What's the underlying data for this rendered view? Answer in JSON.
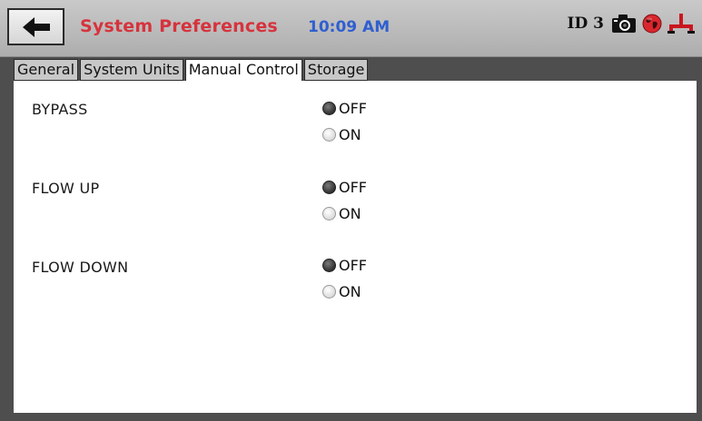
{
  "header": {
    "title": "System Preferences",
    "time": "10:09 AM",
    "id_label": "ID 3",
    "icons": [
      "back-arrow-icon",
      "camera-icon",
      "globe-icon",
      "network-icon"
    ]
  },
  "tabs": [
    {
      "label": "General",
      "active": false
    },
    {
      "label": "System Units",
      "active": false
    },
    {
      "label": "Manual Control",
      "active": true
    },
    {
      "label": "Storage",
      "active": false
    }
  ],
  "controls": [
    {
      "label": "BYPASS",
      "options": [
        "OFF",
        "ON"
      ],
      "selected": "OFF"
    },
    {
      "label": "FLOW UP",
      "options": [
        "OFF",
        "ON"
      ],
      "selected": "OFF"
    },
    {
      "label": "FLOW DOWN",
      "options": [
        "OFF",
        "ON"
      ],
      "selected": "OFF"
    }
  ],
  "colors": {
    "title": "#d6333d",
    "time": "#2f5fd0",
    "globe": "#d9262e"
  }
}
